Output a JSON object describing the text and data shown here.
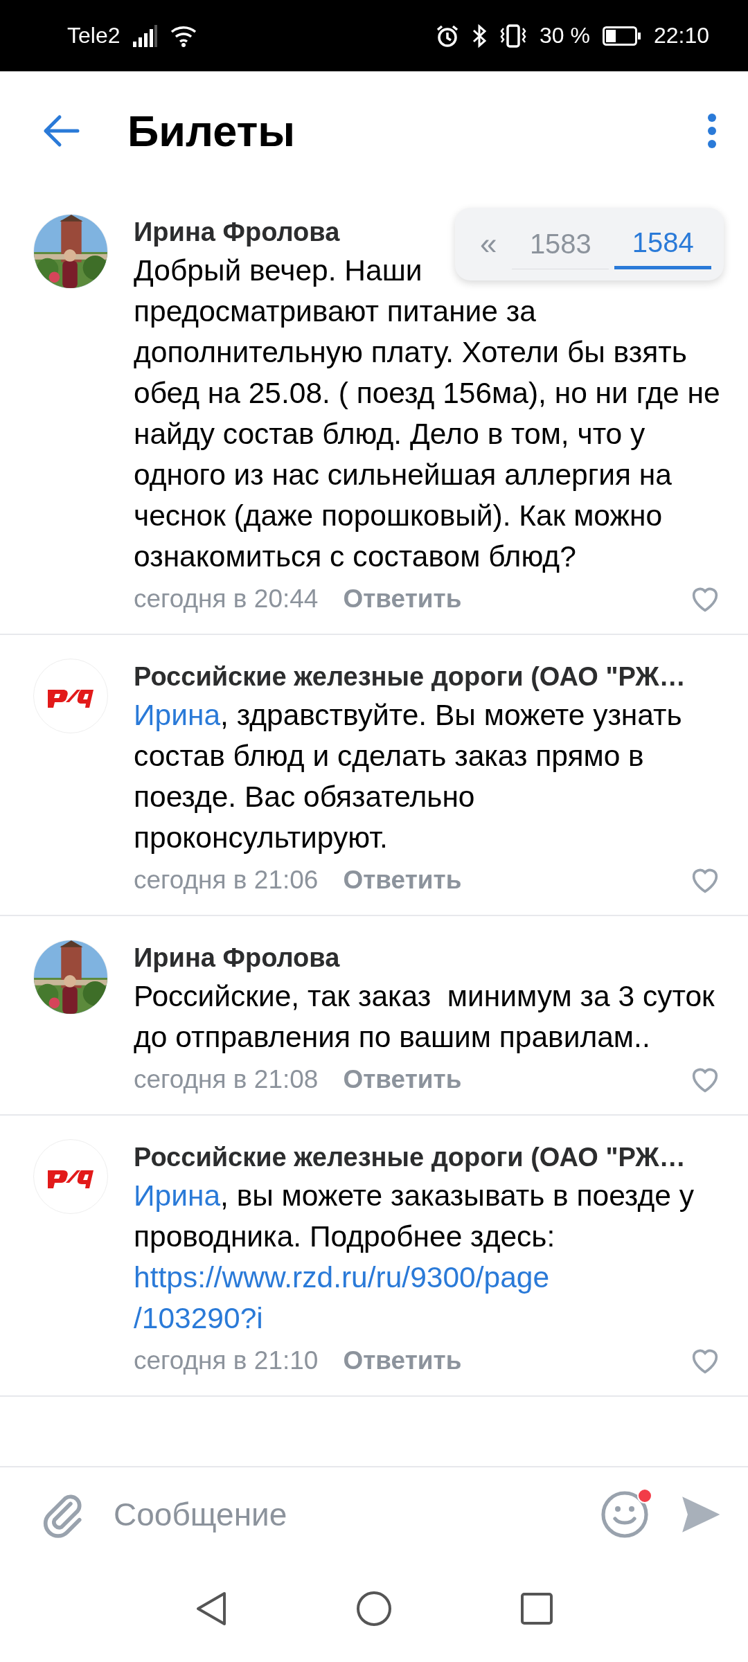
{
  "status_bar": {
    "carrier": "Tele2",
    "battery_text": "30 %",
    "time": "22:10"
  },
  "header": {
    "title": "Билеты"
  },
  "pager": {
    "items": [
      {
        "label": "«",
        "kind": "arrow",
        "selected": false
      },
      {
        "label": "1583",
        "kind": "page",
        "selected": false
      },
      {
        "label": "1584",
        "kind": "page",
        "selected": true
      }
    ]
  },
  "comments": [
    {
      "author": "Ирина Фролова",
      "kind": "person",
      "segments": [
        {
          "kind": "text",
          "text": "Добрый вечер. Наши"
        },
        {
          "kind": "break"
        },
        {
          "kind": "text",
          "text": "предосматривают питание за дополнительную плату. Хотели бы взять обед на 25.08. ( поезд 156ма), но ни где не найду состав блюд. Дело в том, что у одного из нас сильнейшая аллергия на   чеснок (даже порошковый). Как можно ознакомиться с составом блюд?"
        }
      ],
      "time": "сегодня в 20:44",
      "reply": "Ответить"
    },
    {
      "author": "Российские железные дороги (ОАО \"РЖ…",
      "kind": "company",
      "segments": [
        {
          "kind": "mention",
          "text": "Ирина"
        },
        {
          "kind": "text",
          "text": ", здравствуйте. Вы можете узнать состав блюд и сделать заказ прямо в поезде. Вас обязательно проконсультируют."
        }
      ],
      "time": "сегодня в 21:06",
      "reply": "Ответить"
    },
    {
      "author": "Ирина Фролова",
      "kind": "person",
      "segments": [
        {
          "kind": "text",
          "text": "Российские, так заказ  минимум за 3 суток до отправления по вашим правилам.."
        }
      ],
      "time": "сегодня в 21:08",
      "reply": "Ответить"
    },
    {
      "author": "Российские железные дороги (ОАО \"РЖ…",
      "kind": "company",
      "segments": [
        {
          "kind": "mention",
          "text": "Ирина"
        },
        {
          "kind": "text",
          "text": ", вы можете заказывать в поезде у проводника. Подробнее здесь: "
        },
        {
          "kind": "link",
          "text": "https://www.rzd.ru/ru/9300/page"
        },
        {
          "kind": "link",
          "text": "/103290?i"
        }
      ],
      "time": "сегодня в 21:10",
      "reply": "Ответить"
    }
  ],
  "composer": {
    "placeholder": "Сообщение",
    "emoji_badge": true
  }
}
